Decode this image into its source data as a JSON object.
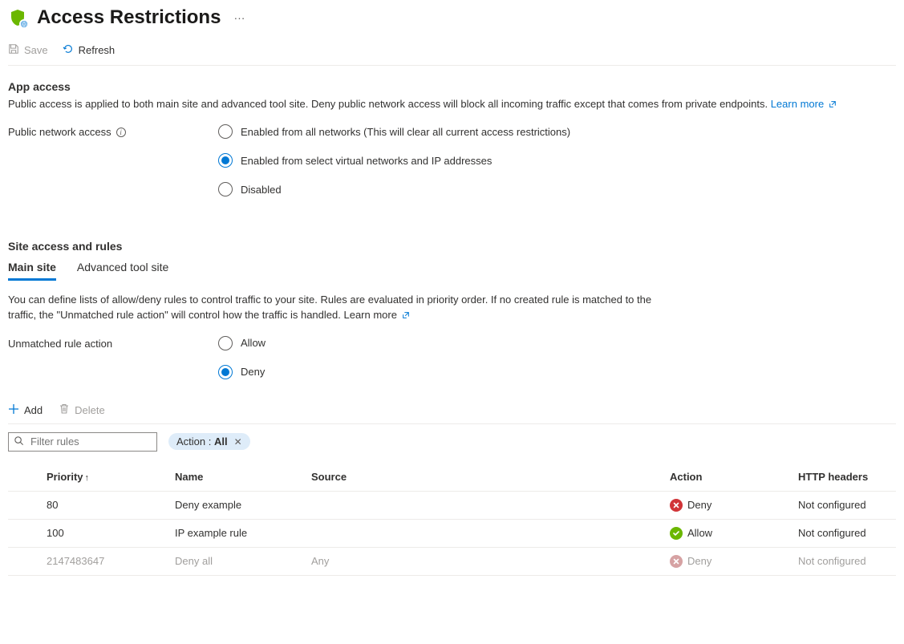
{
  "header": {
    "title": "Access Restrictions"
  },
  "toolbar": {
    "save_label": "Save",
    "refresh_label": "Refresh"
  },
  "app_access": {
    "title": "App access",
    "description": "Public access is applied to both main site and advanced tool site. Deny public network access will block all incoming traffic except that comes from private endpoints.",
    "learn_more": "Learn more",
    "label": "Public network access",
    "options": {
      "all": "Enabled from all networks (This will clear all current access restrictions)",
      "select": "Enabled from select virtual networks and IP addresses",
      "disabled": "Disabled"
    }
  },
  "site_rules": {
    "title": "Site access and rules",
    "tabs": {
      "main": "Main site",
      "advanced": "Advanced tool site"
    },
    "description": "You can define lists of allow/deny rules to control traffic to your site. Rules are evaluated in priority order. If no created rule is matched to the traffic, the \"Unmatched rule action\" will control how the traffic is handled.",
    "learn_more": "Learn more",
    "unmatched_label": "Unmatched rule action",
    "unmatched_options": {
      "allow": "Allow",
      "deny": "Deny"
    }
  },
  "rules_toolbar": {
    "add_label": "Add",
    "delete_label": "Delete"
  },
  "filter": {
    "placeholder": "Filter rules",
    "pill_key": "Action : ",
    "pill_value": "All"
  },
  "table": {
    "headers": {
      "priority": "Priority",
      "name": "Name",
      "source": "Source",
      "action": "Action",
      "http": "HTTP headers"
    },
    "rows": [
      {
        "priority": "80",
        "name": "Deny example",
        "source": "",
        "action": "Deny",
        "action_kind": "deny",
        "http": "Not configured",
        "faded": false
      },
      {
        "priority": "100",
        "name": "IP example rule",
        "source": "",
        "action": "Allow",
        "action_kind": "allow",
        "http": "Not configured",
        "faded": false
      },
      {
        "priority": "2147483647",
        "name": "Deny all",
        "source": "Any",
        "action": "Deny",
        "action_kind": "deny",
        "http": "Not configured",
        "faded": true
      }
    ]
  }
}
